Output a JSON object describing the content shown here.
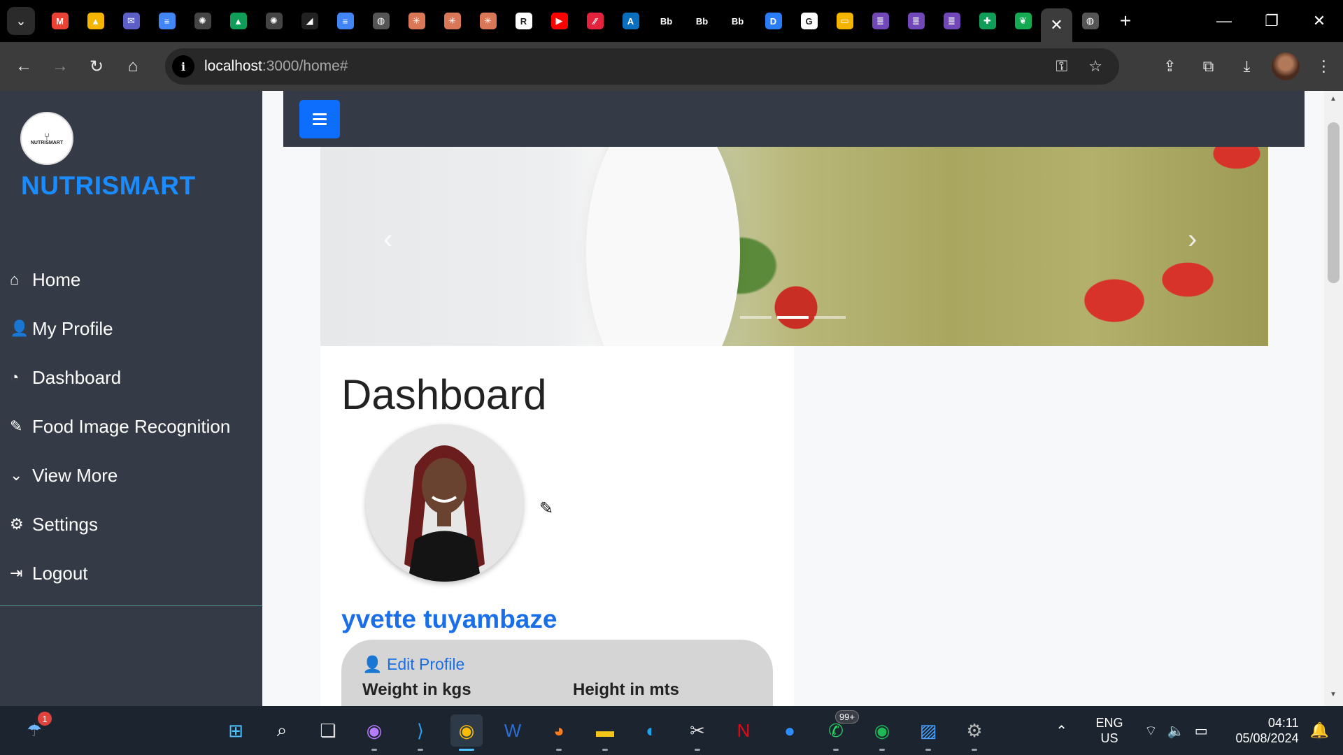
{
  "browser": {
    "url_host": "localhost",
    "url_rest": ":3000/home#",
    "tab_icons": [
      {
        "name": "gmail-icon",
        "glyph": "M",
        "color": "#ea4335"
      },
      {
        "name": "google-drive-icon",
        "glyph": "▲",
        "color": "#f4b400"
      },
      {
        "name": "mail-app-icon",
        "glyph": "✉",
        "color": "#5b5fc7"
      },
      {
        "name": "google-docs-icon",
        "glyph": "≡",
        "color": "#4285f4"
      },
      {
        "name": "chatgpt-icon",
        "glyph": "✺",
        "color": "#444"
      },
      {
        "name": "google-drive-icon-2",
        "glyph": "▲",
        "color": "#0f9d58"
      },
      {
        "name": "chatgpt-icon-2",
        "glyph": "✺",
        "color": "#444"
      },
      {
        "name": "app-icon",
        "glyph": "◢",
        "color": "#222"
      },
      {
        "name": "google-docs-icon-2",
        "glyph": "≡",
        "color": "#4285f4"
      },
      {
        "name": "globe-icon",
        "glyph": "◍",
        "color": "#555"
      },
      {
        "name": "claude-icon",
        "glyph": "✳",
        "color": "#d97757"
      },
      {
        "name": "claude-icon-2",
        "glyph": "✳",
        "color": "#d97757"
      },
      {
        "name": "claude-icon-3",
        "glyph": "✳",
        "color": "#d97757"
      },
      {
        "name": "r6-icon",
        "glyph": "R",
        "color": "#fff"
      },
      {
        "name": "youtube-icon",
        "glyph": "▶",
        "color": "#ff0000"
      },
      {
        "name": "stripe-icon",
        "glyph": "⁄⁄",
        "color": "#e3223e"
      },
      {
        "name": "app-a-icon",
        "glyph": "A",
        "color": "#0a6fbf"
      },
      {
        "name": "blackboard-icon",
        "glyph": "Bb",
        "color": "#000"
      },
      {
        "name": "blackboard-icon-2",
        "glyph": "Bb",
        "color": "#000"
      },
      {
        "name": "blackboard-icon-3",
        "glyph": "Bb",
        "color": "#000"
      },
      {
        "name": "dropbox-icon",
        "glyph": "D",
        "color": "#2a7df6"
      },
      {
        "name": "google-icon",
        "glyph": "G",
        "color": "#fff"
      },
      {
        "name": "google-slides-icon",
        "glyph": "▭",
        "color": "#f4b400"
      },
      {
        "name": "google-forms-icon",
        "glyph": "≣",
        "color": "#7248b9"
      },
      {
        "name": "google-forms-icon-2",
        "glyph": "≣",
        "color": "#7248b9"
      },
      {
        "name": "google-forms-icon-3",
        "glyph": "≣",
        "color": "#7248b9"
      },
      {
        "name": "google-sheets-icon",
        "glyph": "✚",
        "color": "#0f9d58"
      },
      {
        "name": "mongodb-icon",
        "glyph": "❦",
        "color": "#13aa52"
      }
    ]
  },
  "app": {
    "brand": "NUTRISMART",
    "logo_text": "NUTRISMART",
    "menu": [
      {
        "icon": "home-icon",
        "glyph": "⌂",
        "label": "Home"
      },
      {
        "icon": "user-icon",
        "glyph": "👤",
        "label": "My Profile"
      },
      {
        "icon": "dashboard-icon",
        "glyph": "◔",
        "label": "Dashboard"
      },
      {
        "icon": "eyedropper-icon",
        "glyph": "✎",
        "label": "Food Image Recognition"
      },
      {
        "icon": "chevron-down-icon",
        "glyph": "⌄",
        "label": "View More"
      },
      {
        "icon": "gear-icon",
        "glyph": "⚙",
        "label": "Settings"
      },
      {
        "icon": "logout-icon",
        "glyph": "⇥",
        "label": "Logout"
      }
    ],
    "carousel": {
      "slides": 3,
      "active_slide": 2
    },
    "dashboard": {
      "title": "Dashboard",
      "user_name": "yvette tuyambaze",
      "edit_profile": "Edit Profile",
      "weight_label": "Weight in kgs",
      "height_label": "Height in mts"
    }
  },
  "taskbar": {
    "language": "ENG",
    "region": "US",
    "time": "04:11",
    "date": "05/08/2024",
    "whatsapp_badge": "99+",
    "notification_badge": "1"
  }
}
